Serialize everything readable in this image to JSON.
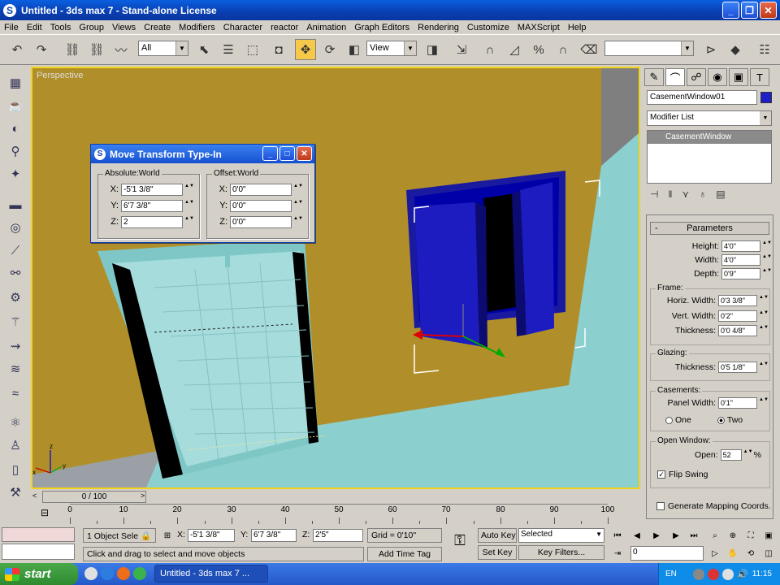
{
  "window": {
    "title": "Untitled - 3ds max 7 - Stand-alone License"
  },
  "menu": [
    "File",
    "Edit",
    "Tools",
    "Group",
    "Views",
    "Create",
    "Modifiers",
    "Character",
    "reactor",
    "Animation",
    "Graph Editors",
    "Rendering",
    "Customize",
    "MAXScript",
    "Help"
  ],
  "toolbar": {
    "selection_filter": "All",
    "ref_coord": "View"
  },
  "viewport": {
    "label": "Perspective"
  },
  "dialog": {
    "title": "Move Transform Type-In",
    "absolute_label": "Absolute:World",
    "offset_label": "Offset:World",
    "absolute": {
      "x": "-5'1 3/8\"",
      "y": "6'7 3/8\"",
      "z": "2"
    },
    "offset": {
      "x": "0'0\"",
      "y": "0'0\"",
      "z": "0'0\""
    },
    "axis_x": "X:",
    "axis_y": "Y:",
    "axis_z": "Z:"
  },
  "panel": {
    "object_name": "CasementWindow01",
    "object_color": "#1f1fc8",
    "modifier_list": "Modifier List",
    "stack_item": "CasementWindow",
    "rollout_title": "Parameters",
    "minus": "-",
    "height_label": "Height:",
    "height": "4'0\"",
    "width_label": "Width:",
    "width": "4'0\"",
    "depth_label": "Depth:",
    "depth": "0'9\"",
    "frame_label": "Frame:",
    "horiz_label": "Horiz. Width:",
    "horiz": "0'3 3/8\"",
    "vert_label": "Vert. Width:",
    "vert": "0'2\"",
    "fthick_label": "Thickness:",
    "fthick": "0'0 4/8\"",
    "glazing_label": "Glazing:",
    "gthick_label": "Thickness:",
    "gthick": "0'5 1/8\"",
    "casements_label": "Casements:",
    "panel_width_label": "Panel Width:",
    "panel_width": "0'1\"",
    "radio_one": "One",
    "radio_two": "Two",
    "open_window_label": "Open Window:",
    "open_label": "Open:",
    "open_value": "52",
    "open_unit": "%",
    "flip_swing": "Flip Swing",
    "gen_mapping": "Generate Mapping Coords."
  },
  "timeline": {
    "frame_display": "0 / 100",
    "ticks": [
      "0",
      "10",
      "20",
      "30",
      "40",
      "50",
      "60",
      "70",
      "80",
      "90",
      "100"
    ]
  },
  "status": {
    "selection": "1 Object Sele",
    "x": "-5'1 3/8\"",
    "y": "6'7 3/8\"",
    "z": "2'5\"",
    "x_label": "X:",
    "y_label": "Y:",
    "z_label": "Z:",
    "grid": "Grid = 0'10\"",
    "prompt": "Click and drag to select and move objects",
    "add_time_tag": "Add Time Tag",
    "auto_key": "Auto Key",
    "set_key": "Set Key",
    "key_mode": "Selected",
    "key_filters": "Key Filters...",
    "frame": "0"
  },
  "taskbar": {
    "start": "start",
    "task": "Untitled - 3ds max 7 ...",
    "lang": "EN",
    "clock": "11:15"
  }
}
